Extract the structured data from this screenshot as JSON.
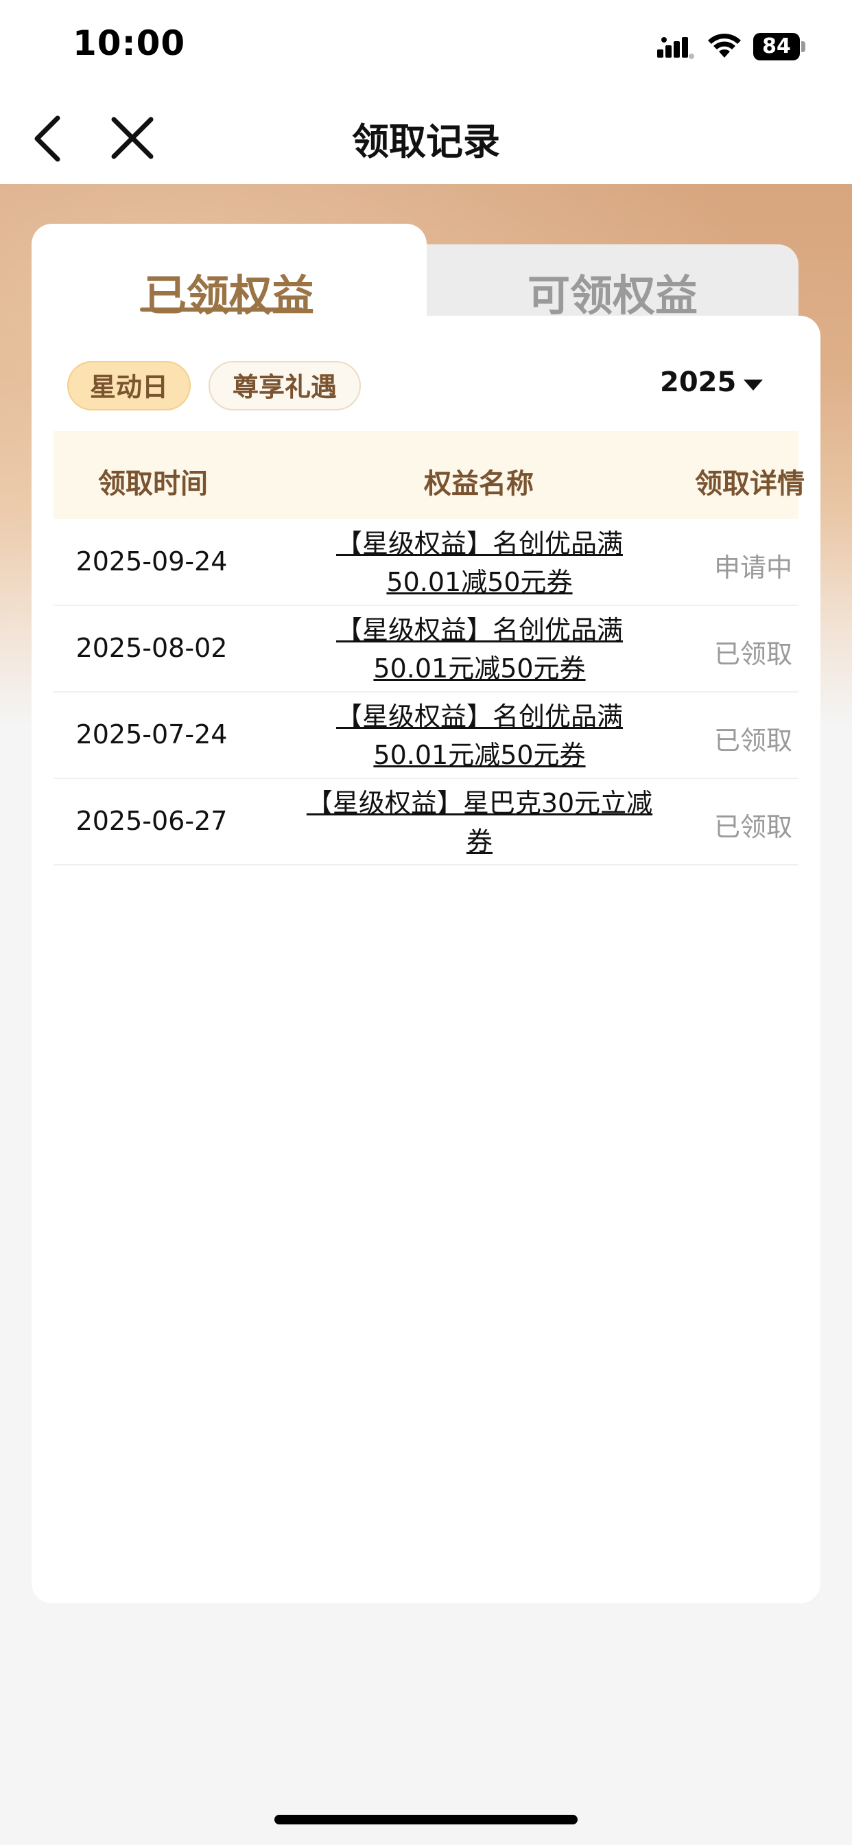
{
  "status_bar": {
    "time": "10:00",
    "battery": "84"
  },
  "nav": {
    "title": "领取记录",
    "back_icon": "chevron-left-icon",
    "close_icon": "close-icon"
  },
  "tabs": [
    {
      "label": "已领权益",
      "active": true
    },
    {
      "label": "可领权益",
      "active": false
    }
  ],
  "filters": {
    "chips": [
      {
        "label": "星动日",
        "selected": true
      },
      {
        "label": "尊享礼遇",
        "selected": false
      }
    ],
    "year": "2025"
  },
  "table": {
    "headers": [
      "领取时间",
      "权益名称",
      "领取详情"
    ],
    "rows": [
      {
        "date": "2025-09-24",
        "name": "【星级权益】名创优品满\n50.01减50元券",
        "status": "申请中"
      },
      {
        "date": "2025-08-02",
        "name": "【星级权益】名创优品满\n50.01元减50元券",
        "status": "已领取"
      },
      {
        "date": "2025-07-24",
        "name": "【星级权益】名创优品满\n50.01元减50元券",
        "status": "已领取"
      },
      {
        "date": "2025-06-27",
        "name": "【星级权益】星巴克30元立减\n券",
        "status": "已领取"
      }
    ]
  },
  "colors": {
    "accent": "#9b7446",
    "chip_selected_bg": "#fbe2b0",
    "header_bg": "#fdf8ea",
    "status_gray": "#9a9a9a"
  }
}
